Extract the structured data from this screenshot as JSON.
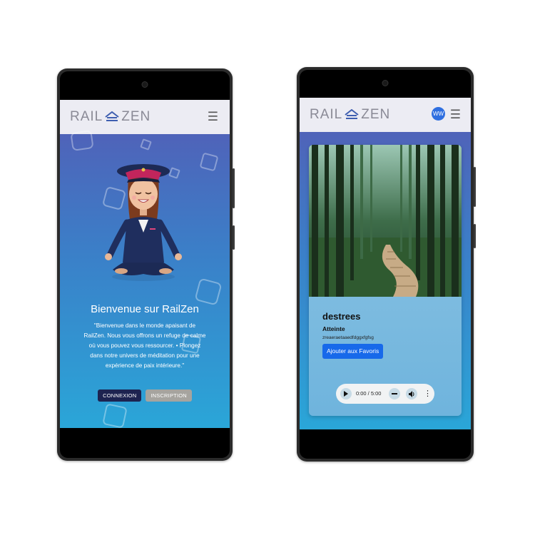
{
  "left_phone": {
    "logo_left": "RAIL",
    "logo_right": "ZEN",
    "menu_icon": "hamburger-icon",
    "welcome_title": "Bienvenue sur RailZen",
    "welcome_text": "\"Bienvenue dans le monde apaisant de RailZen. Nous vous offrons un refuge de calme où vous pouvez vous ressourcer.  •      Plongez dans notre univers de méditation pour une expérience de paix intérieure.\"",
    "login_label": "CONNEXION",
    "signup_label": "INSCRIPTION"
  },
  "right_phone": {
    "logo_left": "RAIL",
    "logo_right": "ZEN",
    "avatar_initials": "WW",
    "menu_icon": "hamburger-icon",
    "card": {
      "title": "destrees",
      "subtitle": "Atteinte",
      "description": "zreaeraetaaedfdggxfgfsg",
      "favorite_label": "Ajouter aux Favoris"
    },
    "audio": {
      "time": "0:00 / 5:00"
    }
  },
  "colors": {
    "appbar": "#ececf3",
    "hero_top": "#4f63b9",
    "hero_bottom": "#2aa6d8",
    "btn_dark": "#1d2350",
    "btn_grey": "#a6a49f",
    "fav_btn": "#1769ea"
  }
}
